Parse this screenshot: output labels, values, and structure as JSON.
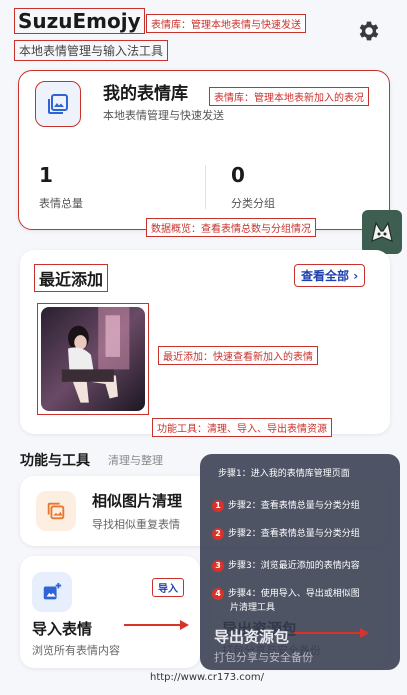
{
  "header": {
    "app_title": "SuzuEmojy",
    "subtitle": "本地表情管理与输入法工具",
    "title_tag": "表情库：管理本地表情与快速发送"
  },
  "library_card": {
    "title": "我的表情库",
    "subtitle": "本地表情管理与快速发送",
    "tag": "表情库：管理本地表新加入的表况",
    "total_value": "1",
    "total_label": "表情总量",
    "groups_value": "0",
    "groups_label": "分类分组"
  },
  "stats_tag": "数据概览：查看表情总数与分组情况",
  "recent": {
    "title": "最近添加",
    "view_all": "查看全部",
    "tag": "最近添加：快速查看新加入的表情",
    "tools_tag": "功能工具：清理、导入、导出表情资源"
  },
  "tools": {
    "section_title": "功能与工具",
    "section_sub": "清理与整理",
    "similar": {
      "title": "相似图片清理",
      "subtitle": "导找相似重复表情"
    },
    "import": {
      "title": "导入表情",
      "subtitle": "浏览所有表情内容",
      "tag": "导入"
    },
    "export": {
      "title": "导出资源包",
      "subtitle": "打包分享与安全备份"
    }
  },
  "overlay": {
    "step1": "步骤1：进入我的表情库管理页面",
    "steps": [
      {
        "num": "1",
        "text": "步骤2：查看表情总量与分类分组"
      },
      {
        "num": "2",
        "text": "步骤2：查看表情总量与分类分组"
      },
      {
        "num": "3",
        "text": "步骤3：浏览最近添加的表情内容"
      },
      {
        "num": "4",
        "text": "步骤4：使用导入、导出或相似图"
      }
    ],
    "step4_cont": "片清理工具"
  },
  "footer": {
    "url": "http://www.cr173.com/"
  },
  "colors": {
    "annotation_red": "#c8322d",
    "accent_blue": "#2f64d6",
    "accent_orange": "#e8762c"
  }
}
